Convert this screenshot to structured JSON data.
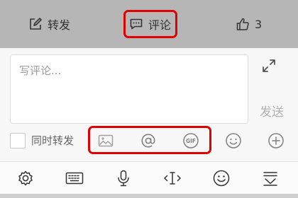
{
  "action_bar": {
    "repost": {
      "label": "转发",
      "icon": "edit-icon"
    },
    "comment": {
      "label": "评论",
      "icon": "comment-icon"
    },
    "like": {
      "count": "3",
      "icon": "thumbs-up-icon"
    }
  },
  "composer": {
    "placeholder": "写评论...",
    "value": "",
    "send_label": "发送",
    "expand_icon": "expand-icon",
    "also_repost_label": "同时转发",
    "also_repost_checked": false,
    "tools": [
      "image-icon",
      "at-mention-icon",
      "gif-icon",
      "emoji-icon",
      "add-icon"
    ]
  },
  "keyboard_toolbar": {
    "icons": [
      "settings-icon",
      "keyboard-icon",
      "microphone-icon",
      "cursor-move-icon",
      "emoji-keyboard-icon",
      "hide-keyboard-icon"
    ]
  },
  "colors": {
    "highlight": "#e00000",
    "action_bar_bg": "#b6b6b6",
    "send_text": "#b0b0b0"
  }
}
